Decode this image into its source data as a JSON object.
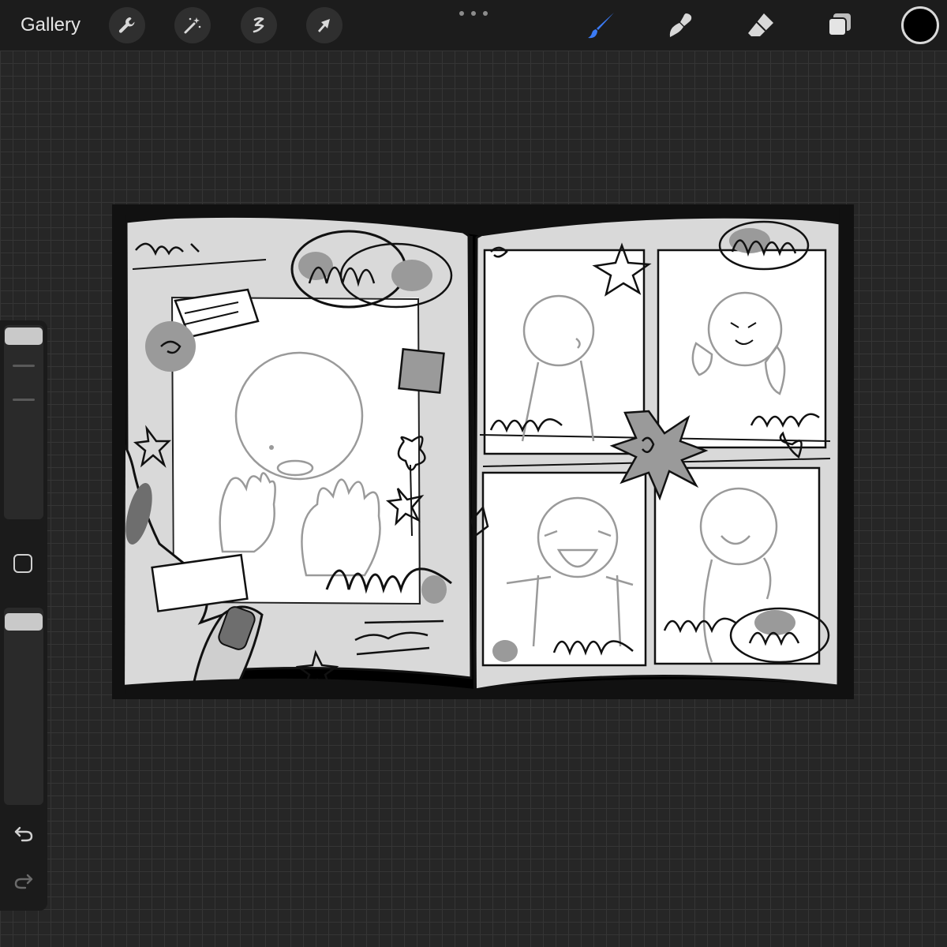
{
  "toolbar": {
    "gallery_label": "Gallery",
    "left_tools": [
      "wrench-icon",
      "magic-wand-icon",
      "selection-icon",
      "transform-arrow-icon"
    ],
    "right_tools": [
      "brush-icon",
      "smudge-icon",
      "eraser-icon",
      "layers-icon"
    ],
    "active_tool": "brush",
    "accent_color": "#3b7bf5",
    "current_color": "#000000"
  },
  "sidebar": {
    "brush_size_level": 0.0,
    "opacity_level": 0.0,
    "icons": [
      "modify-square-icon",
      "undo-icon",
      "redo-icon"
    ]
  },
  "canvas": {
    "description_colors": {
      "page": "#d9d9d9",
      "panel": "#ffffff",
      "shade": "#9a9a9a",
      "ink": "#111111"
    }
  }
}
